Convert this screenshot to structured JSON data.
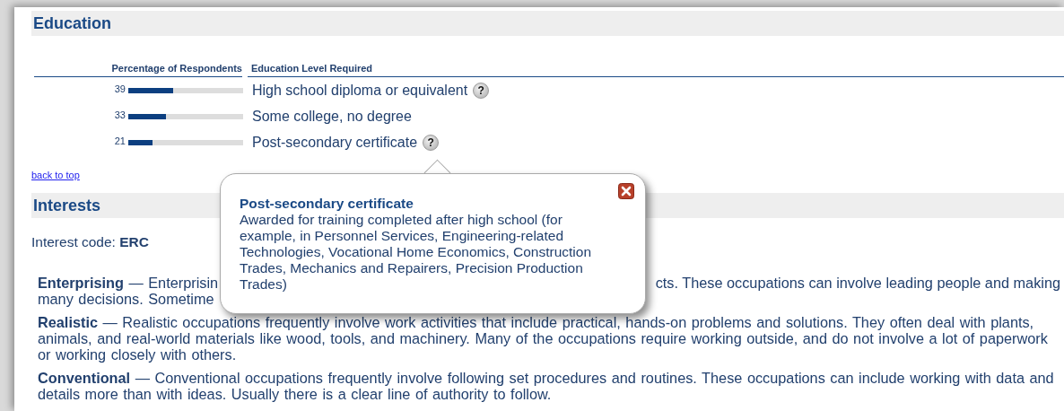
{
  "education": {
    "title": "Education",
    "columns": [
      "Percentage of Respondents",
      "Education Level Required"
    ],
    "rows": [
      {
        "percent": "39",
        "level": 0.39,
        "label": "High school diploma or equivalent",
        "help": "?"
      },
      {
        "percent": "33",
        "level": 0.33,
        "label": "Some college, no degree"
      },
      {
        "percent": "21",
        "level": 0.21,
        "label": "Post-secondary certificate",
        "help": "?"
      }
    ],
    "back_link": "back to top"
  },
  "popup": {
    "title": "Post-secondary certificate",
    "body": "Awarded for training completed after high school (for example, in Personnel Services, Engineering-related Technologies, Vocational Home Economics, Construction Trades, Mechanics and Repairers, Precision Production Trades)"
  },
  "interests": {
    "title": "Interests",
    "code_label": "Interest code:",
    "code": "ERC",
    "paragraphs": [
      {
        "kind": "covered",
        "line1_left": "**Enterprising** — Enterprisin",
        "line1_right": "cts. These occupations can involve leading people and making",
        "line2_left": "many decisions. Sometime"
      },
      {
        "kind": "full",
        "text": "**Realistic** — Realistic occupations frequently involve work activities that include practical, hands-on problems and solutions. They often deal with plants, animals, and real-world materials like wood, tools, and machinery. Many of the occupations require working outside, and do not involve a lot of paperwork or working closely with others."
      },
      {
        "kind": "full",
        "text": "**Conventional** — Conventional occupations frequently involve following set procedures and routines. These occupations can include working with data and details more than with ideas. Usually there is a clear line of authority to follow."
      }
    ]
  }
}
